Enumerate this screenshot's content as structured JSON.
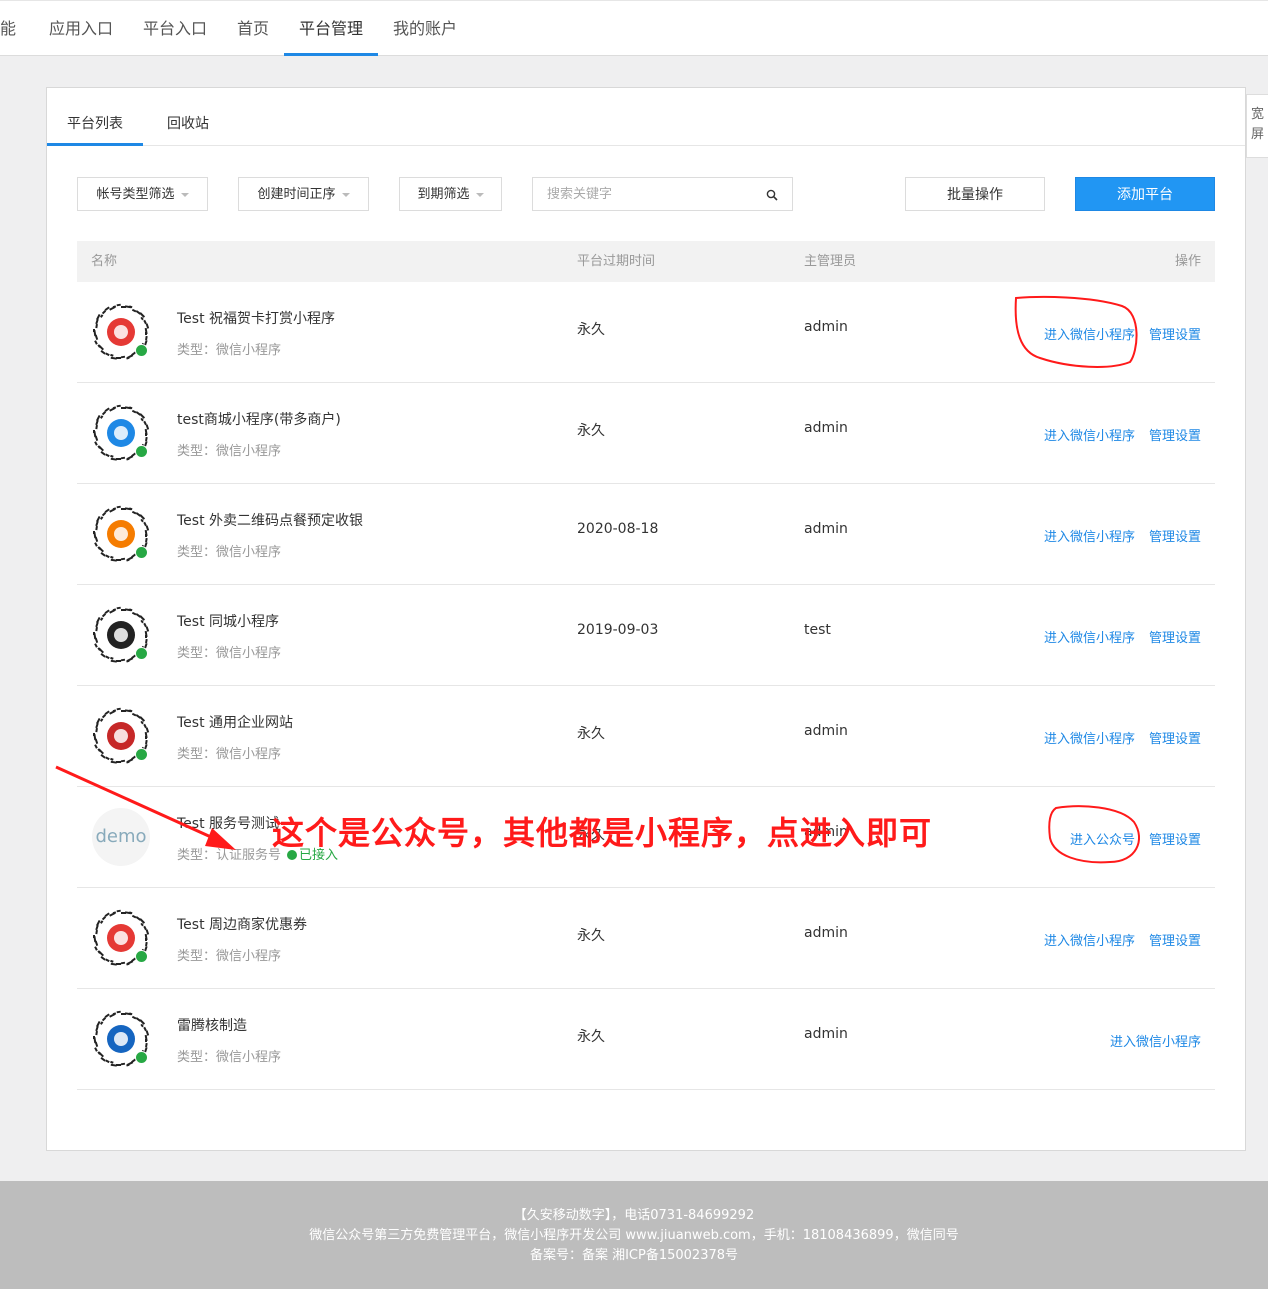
{
  "topnav": {
    "items": [
      {
        "label": "功能"
      },
      {
        "label": "应用入口"
      },
      {
        "label": "平台入口"
      },
      {
        "label": "首页"
      },
      {
        "label": "平台管理"
      },
      {
        "label": "我的账户"
      }
    ],
    "active_index": 4
  },
  "side_button": {
    "label": "宽屏"
  },
  "tabs": [
    {
      "label": "平台列表"
    },
    {
      "label": "回收站"
    }
  ],
  "filters": {
    "account_type": "帐号类型筛选",
    "created_sort": "创建时间正序",
    "expire_filter": "到期筛选",
    "search_placeholder": "搜索关键字"
  },
  "buttons": {
    "batch": "批量操作",
    "add": "添加平台"
  },
  "table": {
    "headers": {
      "name": "名称",
      "expire": "平台过期时间",
      "admin": "主管理员",
      "ops": "操作"
    },
    "rows": [
      {
        "name": "Test 祝福贺卡打赏小程序",
        "type": "类型：微信小程序",
        "expire": "永久",
        "admin": "admin",
        "enter": "进入微信小程序",
        "manage": "管理设置",
        "logo_color": "#e53935"
      },
      {
        "name": "test商城小程序(带多商户)",
        "type": "类型：微信小程序",
        "expire": "永久",
        "admin": "admin",
        "enter": "进入微信小程序",
        "manage": "管理设置",
        "logo_color": "#1e88e5"
      },
      {
        "name": "Test 外卖二维码点餐预定收银",
        "type": "类型：微信小程序",
        "expire": "2020-08-18",
        "admin": "admin",
        "enter": "进入微信小程序",
        "manage": "管理设置",
        "logo_color": "#f57c00"
      },
      {
        "name": "Test 同城小程序",
        "type": "类型：微信小程序",
        "expire": "2019-09-03",
        "admin": "test",
        "enter": "进入微信小程序",
        "manage": "管理设置",
        "logo_color": "#222222"
      },
      {
        "name": "Test 通用企业网站",
        "type": "类型：微信小程序",
        "expire": "永久",
        "admin": "admin",
        "enter": "进入微信小程序",
        "manage": "管理设置",
        "logo_color": "#c62828"
      },
      {
        "name": "Test 服务号测试",
        "type": "类型：认证服务号",
        "status": "已接入",
        "expire": "永久",
        "admin": "admin",
        "enter": "进入公众号",
        "manage": "管理设置",
        "logo_text": "demo"
      },
      {
        "name": "Test 周边商家优惠券",
        "type": "类型：微信小程序",
        "expire": "永久",
        "admin": "admin",
        "enter": "进入微信小程序",
        "manage": "管理设置",
        "logo_color": "#e53935"
      },
      {
        "name": "雷腾核制造",
        "type": "类型：微信小程序",
        "expire": "永久",
        "admin": "admin",
        "enter": "进入微信小程序",
        "logo_color": "#1565c0"
      }
    ]
  },
  "annotation": {
    "text": "这个是公众号，其他都是小程序，点进入即可",
    "color": "#ff1a1a"
  },
  "footer": {
    "line1": "【久安移动数字】，电话0731-84699292",
    "line2": "微信公众号第三方免费管理平台，微信小程序开发公司 www.jiuanweb.com，手机：18108436899，微信同号",
    "line3": "备案号：备案 湘ICP备15002378号"
  },
  "colors": {
    "accent": "#1e88e5",
    "add_button": "#2196f3",
    "success": "#27a844"
  }
}
